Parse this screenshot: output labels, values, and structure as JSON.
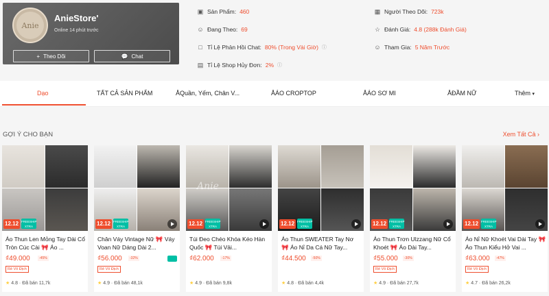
{
  "shop": {
    "name": "AnieStore'",
    "online": "Online 14 phút trước",
    "follow_label": "Theo Dõi",
    "chat_label": "Chat",
    "avatar_text": "Anie"
  },
  "stats": {
    "products_label": "Sản Phẩm:",
    "products_value": "460",
    "following_label": "Đang Theo:",
    "following_value": "69",
    "chat_rate_label": "Tỉ Lệ Phản Hồi Chat:",
    "chat_rate_value": "80% (Trong Vài Giờ)",
    "cancel_label": "Tỉ Lệ Shop Hủy Đơn:",
    "cancel_value": "2%",
    "followers_label": "Người Theo Dõi:",
    "followers_value": "723k",
    "rating_label": "Đánh Giá:",
    "rating_value": "4.8 (288k Đánh Giá)",
    "joined_label": "Tham Gia:",
    "joined_value": "5 Năm Trước"
  },
  "tabs": [
    "Dạo",
    "TẤT CẢ SẢN PHẨM",
    "Quần, Yếm, Chân V...",
    "ÁO CROPTOP",
    "ÁO SƠ MI",
    "ĐẦM NỮ",
    "Thêm"
  ],
  "section": {
    "title": "GỢI Ý CHO BẠN",
    "see_all": "Xem Tất Cả"
  },
  "badges": {
    "sale": "12.12",
    "free_ship": "FREESHIP XTRA",
    "tag": "Rẻ Vô Địch"
  },
  "products": [
    {
      "title": "Áo Thun Len Mỏng Tay Dài Cổ Tròn Cúc Cài 🎀 Áo ...",
      "price": "₫49.000",
      "discount": "-45%",
      "rating": "4.8",
      "sold": "Đã bán 11,7k",
      "video": false
    },
    {
      "title": "Chân Váy Vintage Nữ 🎀 Váy Voan Nữ Dáng Dài 2...",
      "price": "₫56.000",
      "discount": "-32%",
      "rating": "4.9",
      "sold": "Đã bán 48,1k",
      "video": true
    },
    {
      "title": "Túi Đeo Chéo Khóa Kéo Hàn Quốc 🎀 Túi Vải...",
      "price": "₫62.000",
      "discount": "-17%",
      "rating": "4.9",
      "sold": "Đã bán 9,8k",
      "video": true
    },
    {
      "title": "Áo Thun SWEATER Tay Nơ 🎀 Áo Nỉ Da Cá Nữ Tay...",
      "price": "₫44.500",
      "discount": "-50%",
      "rating": "4.8",
      "sold": "Đã bán 4,4k",
      "video": true
    },
    {
      "title": "Áo Thun Trơn Ulzzang Nữ Cổ Khoét 🎀 Áo Dài Tay...",
      "price": "₫55.000",
      "discount": "-30%",
      "rating": "4.9",
      "sold": "Đã bán 27,7k",
      "video": true
    },
    {
      "title": "Áo Nỉ Nữ Khoét Vai Dài Tay 🎀 Áo Thun Kiểu Hở Vai ...",
      "price": "₫63.000",
      "discount": "-47%",
      "rating": "4.7",
      "sold": "Đã bán 26,2k",
      "video": true
    }
  ],
  "colors": {
    "accent": "#ee4d2d",
    "free_ship": "#00bfa5"
  }
}
